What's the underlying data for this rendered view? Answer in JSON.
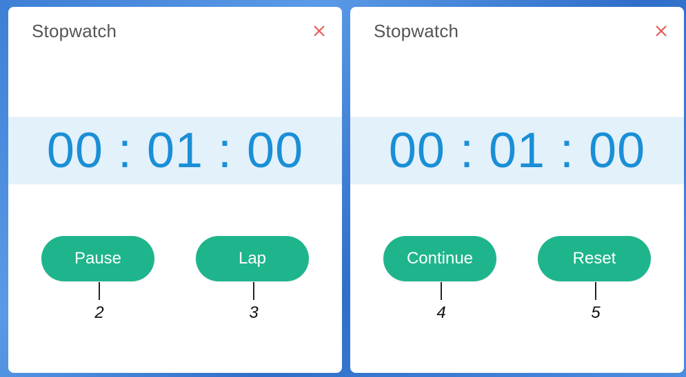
{
  "colors": {
    "accent_button": "#1fb58c",
    "time_text": "#1a8fd6",
    "time_band": "#e3f1fb",
    "close_icon": "#e8554e"
  },
  "panels": [
    {
      "title": "Stopwatch",
      "close_icon": "close-icon",
      "time": "00 : 01 : 00",
      "buttons": [
        {
          "label": "Pause",
          "callout": "2"
        },
        {
          "label": "Lap",
          "callout": "3"
        }
      ]
    },
    {
      "title": "Stopwatch",
      "close_icon": "close-icon",
      "time": "00 : 01 : 00",
      "buttons": [
        {
          "label": "Continue",
          "callout": "4"
        },
        {
          "label": "Reset",
          "callout": "5"
        }
      ]
    }
  ]
}
